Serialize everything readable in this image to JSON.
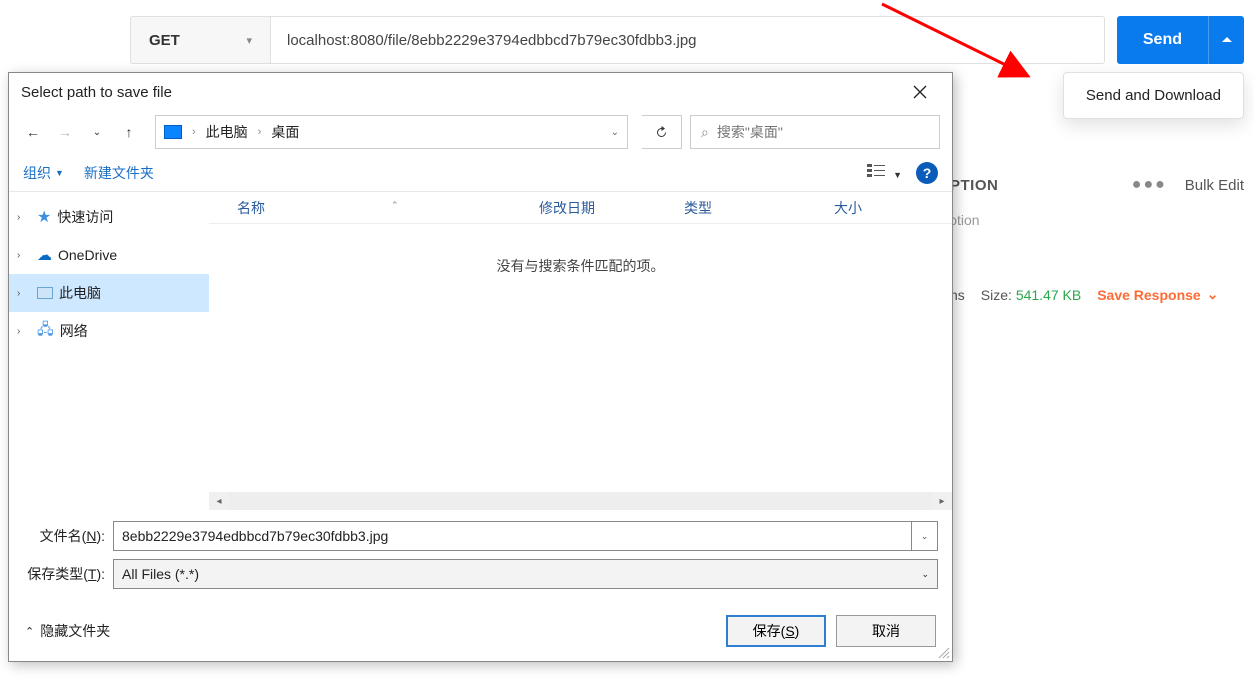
{
  "request": {
    "method": "GET",
    "url": "localhost:8080/file/8ebb2229e3794edbbcd7b79ec30fdbb3.jpg",
    "send_label": "Send",
    "dropdown_item": "Send and Download"
  },
  "panel": {
    "ption": "PTION",
    "bulk_edit": "Bulk Edit",
    "ption_lower": "ɔtion"
  },
  "response": {
    "ns": "ns",
    "size_label": "Size:",
    "size_value": "541.47 KB",
    "save_response": "Save Response"
  },
  "dialog": {
    "title": "Select path to save file",
    "breadcrumb": {
      "root": "此电脑",
      "leaf": "桌面"
    },
    "search_placeholder": "搜索\"桌面\"",
    "toolbar": {
      "organize": "组织",
      "new_folder": "新建文件夹"
    },
    "columns": {
      "name": "名称",
      "modified": "修改日期",
      "type": "类型",
      "size": "大小"
    },
    "empty_message": "没有与搜索条件匹配的项。",
    "sidebar": [
      {
        "label": "快速访问",
        "icon": "star"
      },
      {
        "label": "OneDrive",
        "icon": "cloud"
      },
      {
        "label": "此电脑",
        "icon": "pc",
        "selected": true
      },
      {
        "label": "网络",
        "icon": "net"
      }
    ],
    "filename_label": "文件名(N):",
    "filename_value": "8ebb2229e3794edbbcd7b79ec30fdbb3.jpg",
    "filetype_label": "保存类型(T):",
    "filetype_value": "All Files (*.*)",
    "hide_folders": "隐藏文件夹",
    "save_btn": "保存(S)",
    "cancel_btn": "取消"
  }
}
